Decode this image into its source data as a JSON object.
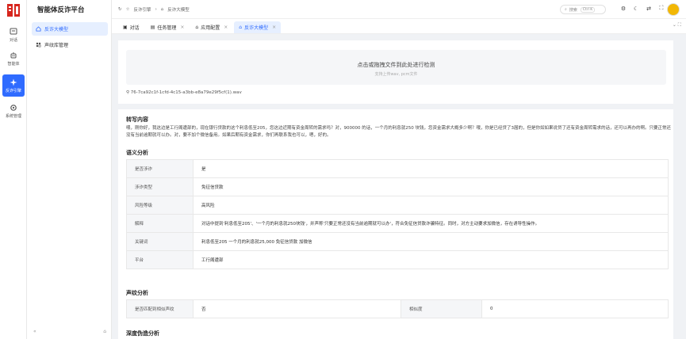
{
  "rail": {
    "items": [
      {
        "label": "对话"
      },
      {
        "label": "智能体"
      },
      {
        "label": "反诈引擎"
      },
      {
        "label": "系统管理"
      }
    ]
  },
  "sidebar": {
    "title": "智能体反诈平台",
    "items": [
      {
        "label": "反诈大模型"
      },
      {
        "label": "声纹库管理"
      }
    ],
    "collapse": "«"
  },
  "topbar": {
    "breadcrumb": [
      "反诈引擎",
      "反诈大模型"
    ],
    "search_placeholder": "搜索",
    "search_shortcut": "Ctrl K"
  },
  "tabs": [
    {
      "label": "对话",
      "closable": false
    },
    {
      "label": "任务管理",
      "closable": true
    },
    {
      "label": "应用配置",
      "closable": true
    },
    {
      "label": "反诈大模型",
      "closable": true
    }
  ],
  "upload": {
    "title": "点击或拖拽文件到此处进行检测",
    "hint": "支持上传wav, pcm文件",
    "file_name": "76-7ca92c1f-1cfd-4c15-a3bb-e8a79e29f5cf(1).wav"
  },
  "transcript": {
    "heading": "转写内容",
    "text": "喂，刚你好，我这边是工行阁遭部的，现在银行贷款的这个利息低至205，您这边近期有资金周转的需求吗？对，900000 的话，一个月的利息就250 块钱，您资金需求大概多少啊？哦，你是已经贷了3届的，但是你如如果说贷了还有资金周转需求的话，还可以再办的啊。只要正常还没有当前逾期就可以办。对，要不加个微信备用。如果后期有资金需求，你们再联系我也可以，嗯，好的。"
  },
  "semantic": {
    "heading": "语义分析",
    "rows": [
      {
        "key": "是否涉诈",
        "value": "是"
      },
      {
        "key": "涉诈类型",
        "value": "免征信贷款"
      },
      {
        "key": "风险等级",
        "value": "高风险"
      },
      {
        "key": "解释",
        "value": "对话中提到'利息低至205'、'一个月的利息就250块钱'，并声称'只要正常还没有当前逾期就可以办'，符合免征信贷款诈骗特征。同时，对方主动要求加微信，存在诱导性操作。"
      },
      {
        "key": "关键词",
        "value": "利息低至205 一个月的利息就25,000 免征信贷款 加微信"
      },
      {
        "key": "平台",
        "value": "工行阁遭部"
      }
    ]
  },
  "voiceprint": {
    "heading": "声纹分析",
    "match_label": "是否匹配到相似声纹",
    "match_value": "否",
    "similarity_label": "相似度",
    "similarity_value": "0"
  },
  "deepfake": {
    "heading": "深度伪造分析"
  }
}
